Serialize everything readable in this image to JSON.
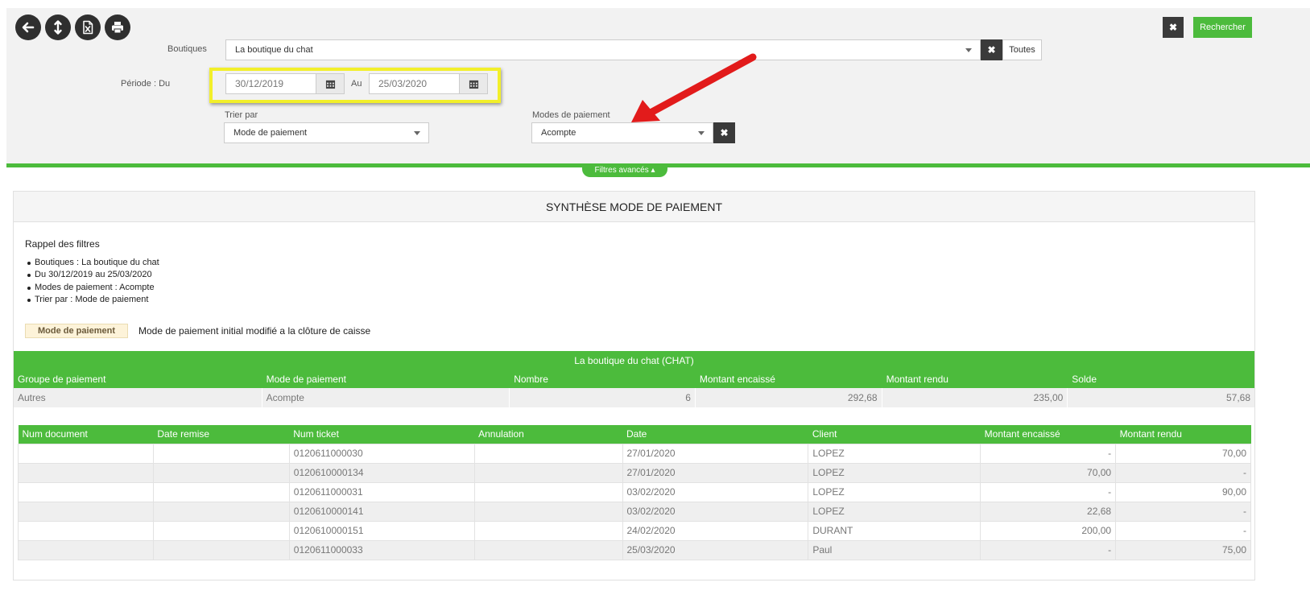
{
  "toolbar": {
    "buttons": [
      "back-arrow-icon",
      "expand-vertical-icon",
      "excel-export-icon",
      "print-icon"
    ],
    "close_label": "✖",
    "search_label": "Rechercher"
  },
  "filters": {
    "boutiques_label": "Boutiques",
    "boutiques_value": "La boutique du chat",
    "boutiques_clear": "✖",
    "toutes_label": "Toutes",
    "periode_label": "Période : Du",
    "date_from": "30/12/2019",
    "au_label": "Au",
    "date_to": "25/03/2020",
    "trier_label": "Trier par",
    "trier_value": "Mode de paiement",
    "modes_label": "Modes de paiement",
    "modes_value": "Acompte",
    "modes_clear": "✖",
    "advanced_label": "Filtres avancés ▴"
  },
  "report": {
    "title": "SYNTHÈSE MODE DE PAIEMENT",
    "rappel_title": "Rappel des filtres",
    "rappel_items": [
      "Boutiques : La boutique du chat",
      "Du 30/12/2019 au 25/03/2020",
      "Modes de paiement : Acompte",
      "Trier par : Mode de paiement"
    ],
    "legend_chip": "Mode de paiement",
    "legend_text": "Mode de paiement initial modifié a la clôture de caisse",
    "group_title": "La boutique du chat (CHAT)",
    "group_columns": [
      "Groupe de paiement",
      "Mode de paiement",
      "Nombre",
      "Montant encaissé",
      "Montant rendu",
      "Solde"
    ],
    "group_row": [
      "Autres",
      "Acompte",
      "6",
      "292,68",
      "235,00",
      "57,68"
    ],
    "detail_columns": [
      "Num document",
      "Date remise",
      "Num ticket",
      "Annulation",
      "Date",
      "Client",
      "Montant encaissé",
      "Montant rendu"
    ],
    "detail_rows": [
      [
        "",
        "",
        "0120611000030",
        "",
        "27/01/2020",
        "LOPEZ",
        "-",
        "70,00"
      ],
      [
        "",
        "",
        "0120610000134",
        "",
        "27/01/2020",
        "LOPEZ",
        "70,00",
        "-"
      ],
      [
        "",
        "",
        "0120611000031",
        "",
        "03/02/2020",
        "LOPEZ",
        "-",
        "90,00"
      ],
      [
        "",
        "",
        "0120610000141",
        "",
        "03/02/2020",
        "LOPEZ",
        "22,68",
        "-"
      ],
      [
        "",
        "",
        "0120610000151",
        "",
        "24/02/2020",
        "DURANT",
        "200,00",
        "-"
      ],
      [
        "",
        "",
        "0120611000033",
        "",
        "25/03/2020",
        "Paul",
        "-",
        "75,00"
      ]
    ]
  },
  "colors": {
    "accent_green": "#4cbb3c",
    "highlight_yellow": "#f2ef2a",
    "annotation_red": "#e21b1b"
  }
}
